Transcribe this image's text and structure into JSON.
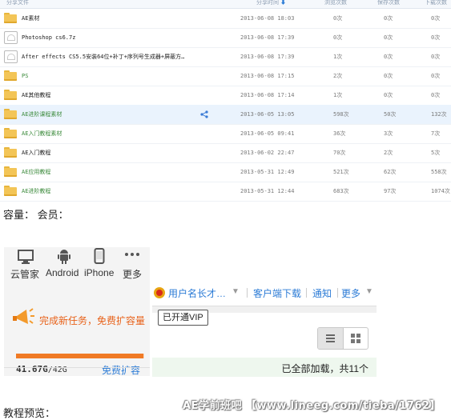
{
  "file_list": {
    "headers": {
      "name": "分享文件",
      "time": "分享时间",
      "views": "浏览次数",
      "saves": "保存次数",
      "downloads": "下载次数"
    },
    "rows": [
      {
        "icon": "folder-icon",
        "name": "AE素材",
        "green": false,
        "date": "2013-06-08 18:03",
        "views": "0次",
        "saves": "0次",
        "downloads": "0次"
      },
      {
        "icon": "file-icon",
        "name": "Photoshop cs6.7z",
        "green": false,
        "date": "2013-06-08 17:39",
        "views": "0次",
        "saves": "0次",
        "downloads": "0次"
      },
      {
        "icon": "file-icon",
        "name": "After effects CS5.5安装64位+补丁+序列号生成器+屏蔽方…",
        "green": false,
        "date": "2013-06-08 17:39",
        "views": "1次",
        "saves": "0次",
        "downloads": "0次"
      },
      {
        "icon": "folder-icon",
        "name": "PS",
        "green": true,
        "date": "2013-06-08 17:15",
        "views": "2次",
        "saves": "0次",
        "downloads": "0次"
      },
      {
        "icon": "folder-icon",
        "name": "AE其他教程",
        "green": false,
        "date": "2013-06-08 17:14",
        "views": "1次",
        "saves": "0次",
        "downloads": "0次"
      },
      {
        "icon": "folder-icon",
        "name": "AE进阶课程素材",
        "green": true,
        "date": "2013-06-05 13:05",
        "views": "598次",
        "saves": "50次",
        "downloads": "132次",
        "highlight": true
      },
      {
        "icon": "folder-icon",
        "name": "AE入门教程素材",
        "green": true,
        "date": "2013-06-05 09:41",
        "views": "36次",
        "saves": "3次",
        "downloads": "7次"
      },
      {
        "icon": "folder-icon",
        "name": "AE入门教程",
        "green": false,
        "date": "2013-06-02 22:47",
        "views": "70次",
        "saves": "2次",
        "downloads": "5次"
      },
      {
        "icon": "folder-icon",
        "name": "AE应用教程",
        "green": true,
        "date": "2013-05-31 12:49",
        "views": "521次",
        "saves": "62次",
        "downloads": "558次"
      },
      {
        "icon": "folder-icon",
        "name": "AE进阶教程",
        "green": true,
        "date": "2013-05-31 12:44",
        "views": "683次",
        "saves": "97次",
        "downloads": "1074次"
      }
    ]
  },
  "capacity_line": "容量： 会员：",
  "cloud_panel": {
    "devices": [
      {
        "icon": "monitor-icon",
        "label": "云管家"
      },
      {
        "icon": "android-icon",
        "label": "Android"
      },
      {
        "icon": "iphone-icon",
        "label": "iPhone"
      },
      {
        "icon": "more-icon",
        "label": "更多"
      }
    ],
    "task_text": "完成新任务，免费扩容量",
    "used": "41.67G",
    "total": "/42G",
    "used_fraction": 0.992,
    "expand_label": "免费扩容"
  },
  "top_bar": {
    "username": "用户名长才…",
    "client_download": "客户端下载",
    "notify": "通知",
    "more": "更多"
  },
  "vip_label": "已开通VIP",
  "loaded_text": "已全部加载，共11个",
  "tutorial_label": "教程预览：",
  "watermark": "AE学前班吧 【www.lineeg.com/tieba/1762】",
  "colors": {
    "accent_orange": "#f07a25",
    "link_blue": "#2b7bd6",
    "green_name": "#3b8a3b"
  }
}
